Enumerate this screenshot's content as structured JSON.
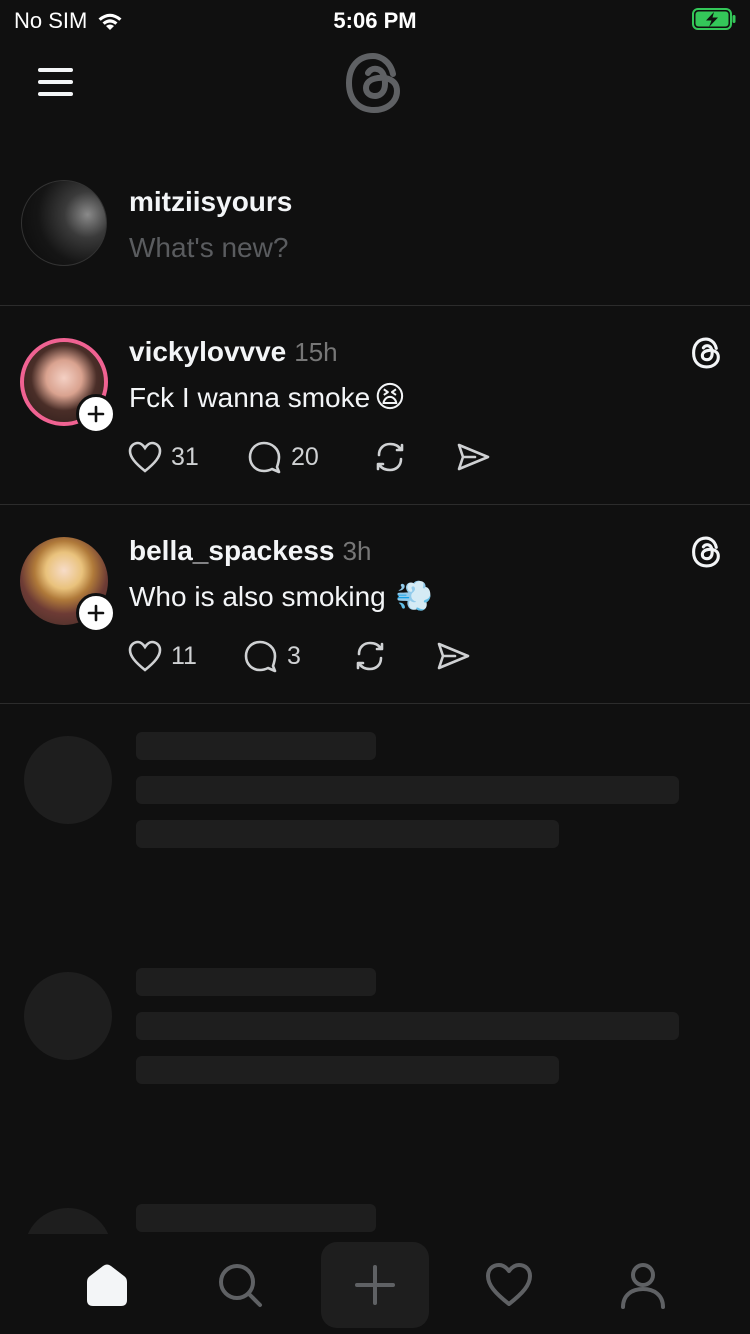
{
  "status_bar": {
    "carrier": "No SIM",
    "time": "5:06 PM"
  },
  "composer": {
    "username": "mitziisyours",
    "placeholder": "What's new?"
  },
  "posts": [
    {
      "username": "vickylovvve",
      "time": "15h",
      "text": "Fck I wanna smoke",
      "emoji": "😫",
      "likes": "31",
      "replies": "20"
    },
    {
      "username": "bella_spackess",
      "time": "3h",
      "text": "Who is also smoking",
      "emoji": "💨",
      "likes": "11",
      "replies": "3"
    }
  ],
  "icons": {
    "status": [
      "wifi-icon",
      "battery-charging-icon"
    ],
    "header": [
      "menu-icon",
      "threads-logo-icon"
    ],
    "post_actions": [
      "heart-icon",
      "comment-icon",
      "repost-icon",
      "share-icon"
    ],
    "tabbar": [
      "home-icon",
      "search-icon",
      "compose-plus-icon",
      "activity-heart-icon",
      "profile-icon"
    ]
  },
  "colors": {
    "background": "#101010",
    "text": "#f3f5f7",
    "muted": "#777777",
    "avatar_ring": "#f06292",
    "battery": "#34c759",
    "skeleton": "#1e1e1e"
  }
}
